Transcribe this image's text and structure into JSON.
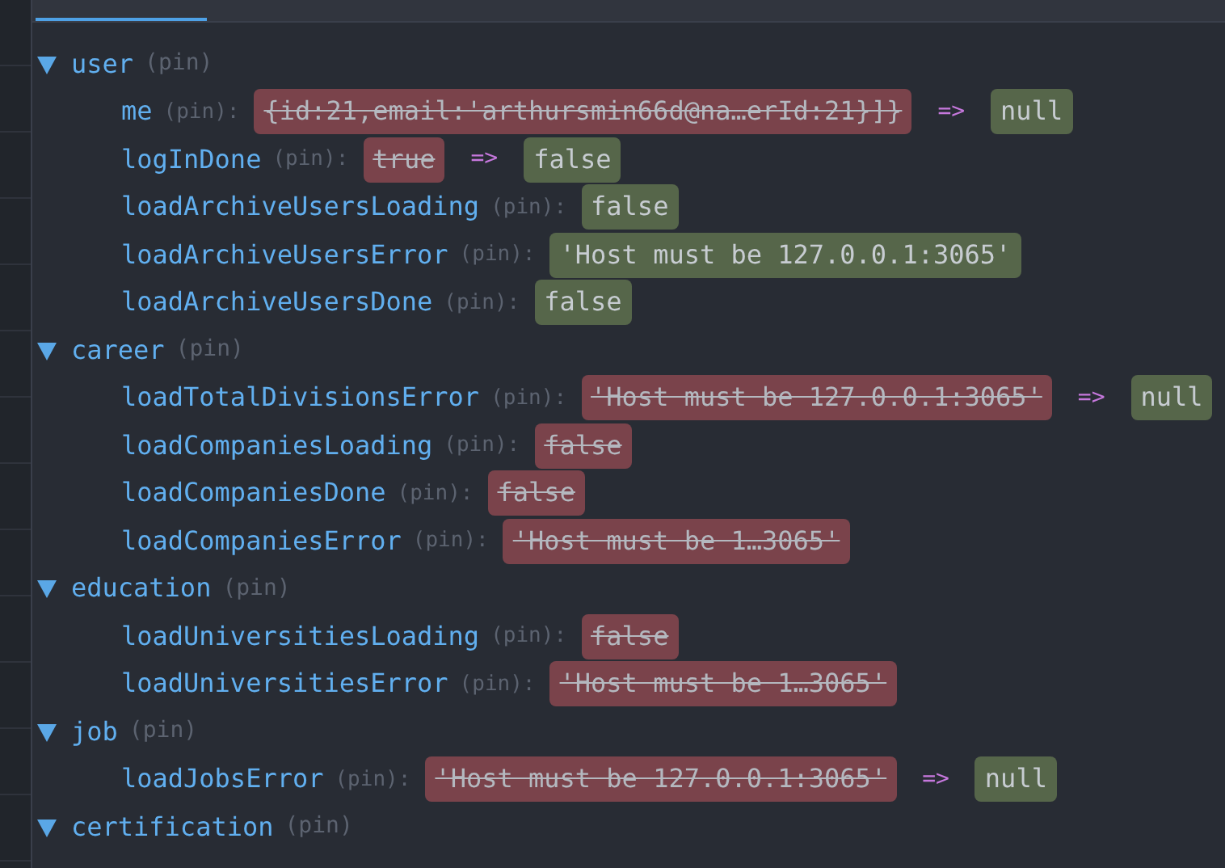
{
  "tabs": [
    {
      "selected": true
    }
  ],
  "tree": [
    {
      "name": "user",
      "pin": "(pin)",
      "expanded": true,
      "children": [
        {
          "key": "me",
          "pin": "(pin):",
          "old": "{id:21,email:'arthursmin66d@na…erId:21}]}",
          "arrow": "=>",
          "new": "null"
        },
        {
          "key": "logInDone",
          "pin": "(pin):",
          "old": "true",
          "arrow": "=>",
          "new": "false"
        },
        {
          "key": "loadArchiveUsersLoading",
          "pin": "(pin):",
          "new": "false"
        },
        {
          "key": "loadArchiveUsersError",
          "pin": "(pin):",
          "new": "'Host must be 127.0.0.1:3065'"
        },
        {
          "key": "loadArchiveUsersDone",
          "pin": "(pin):",
          "new": "false"
        }
      ]
    },
    {
      "name": "career",
      "pin": "(pin)",
      "expanded": true,
      "children": [
        {
          "key": "loadTotalDivisionsError",
          "pin": "(pin):",
          "old": "'Host must be 127.0.0.1:3065'",
          "arrow": "=>",
          "new": "null"
        },
        {
          "key": "loadCompaniesLoading",
          "pin": "(pin):",
          "old": "false"
        },
        {
          "key": "loadCompaniesDone",
          "pin": "(pin):",
          "old": "false"
        },
        {
          "key": "loadCompaniesError",
          "pin": "(pin):",
          "old": "'Host must be 1…3065'"
        }
      ]
    },
    {
      "name": "education",
      "pin": "(pin)",
      "expanded": true,
      "children": [
        {
          "key": "loadUniversitiesLoading",
          "pin": "(pin):",
          "old": "false"
        },
        {
          "key": "loadUniversitiesError",
          "pin": "(pin):",
          "old": "'Host must be 1…3065'"
        }
      ]
    },
    {
      "name": "job",
      "pin": "(pin)",
      "expanded": true,
      "children": [
        {
          "key": "loadJobsError",
          "pin": "(pin):",
          "old": "'Host must be 127.0.0.1:3065'",
          "arrow": "=>",
          "new": "null"
        }
      ]
    },
    {
      "name": "certification",
      "pin": "(pin)",
      "expanded": true
    }
  ]
}
